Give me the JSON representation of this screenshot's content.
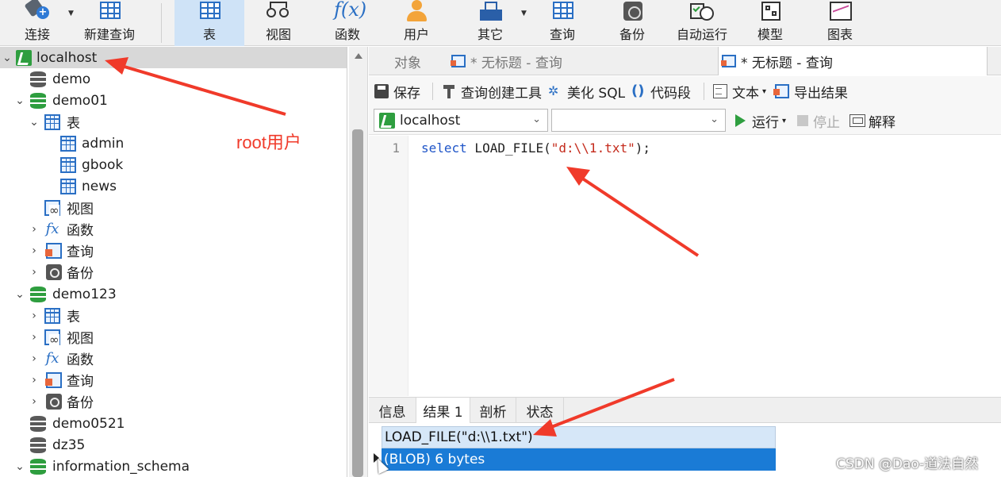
{
  "toolbar": {
    "items": [
      {
        "label": "连接",
        "icon": "plug-icon"
      },
      {
        "label": "新建查询",
        "icon": "new-query-icon"
      },
      {
        "label": "表",
        "icon": "table-icon"
      },
      {
        "label": "视图",
        "icon": "view-icon"
      },
      {
        "label": "函数",
        "icon": "function-icon"
      },
      {
        "label": "用户",
        "icon": "user-icon"
      },
      {
        "label": "其它",
        "icon": "other-icon"
      },
      {
        "label": "查询",
        "icon": "query-icon"
      },
      {
        "label": "备份",
        "icon": "backup-icon"
      },
      {
        "label": "自动运行",
        "icon": "auto-run-icon"
      },
      {
        "label": "模型",
        "icon": "model-icon"
      },
      {
        "label": "图表",
        "icon": "chart-icon"
      }
    ],
    "active": "表"
  },
  "tree": {
    "rows": [
      {
        "label": "localhost",
        "icon": "connection-icon",
        "expanded": true,
        "selected": true
      },
      {
        "label": "demo",
        "icon": "database-icon"
      },
      {
        "label": "demo01",
        "icon": "database-icon",
        "expanded": true
      },
      {
        "label": "表",
        "icon": "table-icon",
        "expanded": true
      },
      {
        "label": "admin",
        "icon": "table-icon"
      },
      {
        "label": "gbook",
        "icon": "table-icon"
      },
      {
        "label": "news",
        "icon": "table-icon"
      },
      {
        "label": "视图",
        "icon": "view-icon"
      },
      {
        "label": "函数",
        "icon": "function-icon"
      },
      {
        "label": "查询",
        "icon": "query-icon"
      },
      {
        "label": "备份",
        "icon": "backup-icon"
      },
      {
        "label": "demo123",
        "icon": "database-icon",
        "expanded": true
      },
      {
        "label": "表",
        "icon": "table-icon"
      },
      {
        "label": "视图",
        "icon": "view-icon"
      },
      {
        "label": "函数",
        "icon": "function-icon"
      },
      {
        "label": "查询",
        "icon": "query-icon"
      },
      {
        "label": "备份",
        "icon": "backup-icon"
      },
      {
        "label": "demo0521",
        "icon": "database-icon"
      },
      {
        "label": "dz35",
        "icon": "database-icon"
      },
      {
        "label": "information_schema",
        "icon": "database-icon"
      }
    ]
  },
  "tabs": [
    {
      "label": "对象"
    },
    {
      "label": "* 无标题 - 查询"
    },
    {
      "label": "* 无标题 - 查询",
      "active": true
    }
  ],
  "query_toolbar": {
    "save": "保存",
    "builder": "查询创建工具",
    "beautify": "美化 SQL",
    "snippet": "代码段",
    "text": "文本",
    "export": "导出结果"
  },
  "selectors": {
    "connection": "localhost",
    "database": "",
    "run": "运行",
    "stop": "停止",
    "explain": "解释"
  },
  "editor": {
    "line_number": "1",
    "kw": "select",
    "fn": " LOAD_FILE(",
    "str": "\"d:\\\\1.txt\"",
    "end": ");"
  },
  "results": {
    "tabs": [
      "信息",
      "结果 1",
      "剖析",
      "状态"
    ],
    "active_tab": "结果 1",
    "column": "LOAD_FILE(\"d:\\\\1.txt\")",
    "cell": "(BLOB) 6 bytes"
  },
  "annotation": {
    "text": "root用户",
    "color": "#f03a2a"
  },
  "watermark": "CSDN @Dao-道法自然",
  "colors": {
    "accent": "#2a6fc4",
    "selection": "#1a7bd6",
    "db_green": "#2e9e3f",
    "annotation": "#f03a2a"
  }
}
